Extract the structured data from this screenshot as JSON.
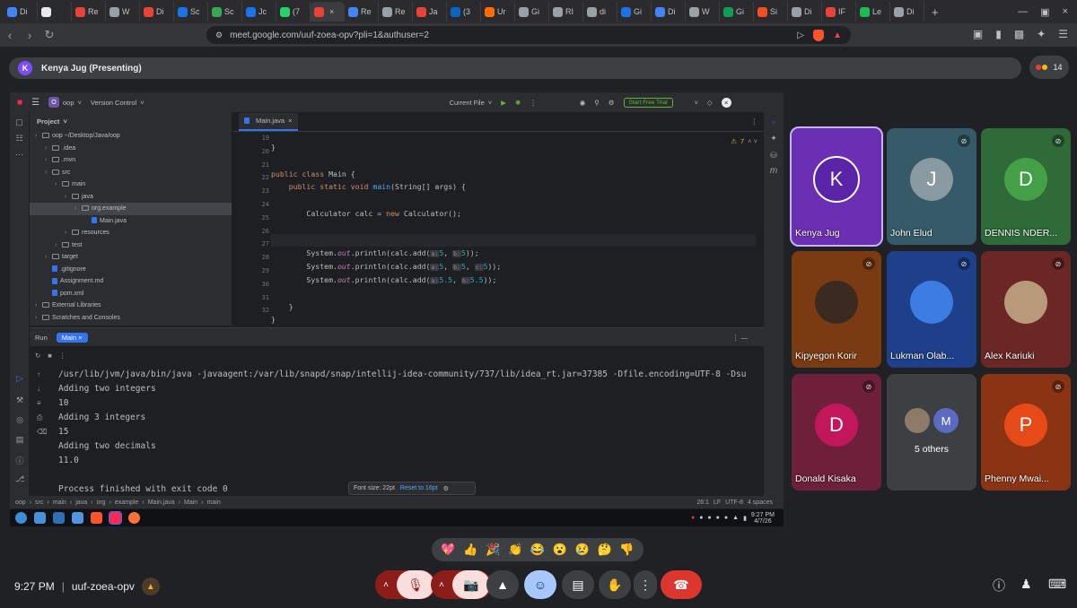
{
  "browser": {
    "tabs": [
      {
        "label": "Di",
        "color": "#4285f4"
      },
      {
        "label": "",
        "color": "#e8eaed"
      },
      {
        "label": "Re",
        "color": "#ea4335"
      },
      {
        "label": "W",
        "color": "#9aa0a6"
      },
      {
        "label": "Di",
        "color": "#ea4335"
      },
      {
        "label": "Sc",
        "color": "#1a73e8"
      },
      {
        "label": "Sc",
        "color": "#34a853"
      },
      {
        "label": "Jc",
        "color": "#1a73e8"
      },
      {
        "label": "(7",
        "color": "#25d366"
      },
      {
        "label": "",
        "color": "#ea4335",
        "active": true
      },
      {
        "label": "Re",
        "color": "#4285f4"
      },
      {
        "label": "Re",
        "color": "#9aa0a6"
      },
      {
        "label": "Ja",
        "color": "#ea4335"
      },
      {
        "label": "(3",
        "color": "#0a66c2"
      },
      {
        "label": "Ur",
        "color": "#ff6d00"
      },
      {
        "label": "Gi",
        "color": "#9aa0a6"
      },
      {
        "label": "RI",
        "color": "#9aa0a6"
      },
      {
        "label": "di",
        "color": "#9aa0a6"
      },
      {
        "label": "Gi",
        "color": "#1a73e8"
      },
      {
        "label": "Di",
        "color": "#4285f4"
      },
      {
        "label": "W",
        "color": "#9aa0a6"
      },
      {
        "label": "Gi",
        "color": "#0f9d58"
      },
      {
        "label": "Si",
        "color": "#f25022"
      },
      {
        "label": "Di",
        "color": "#9aa0a6"
      },
      {
        "label": "IF",
        "color": "#ea4335"
      },
      {
        "label": "Le",
        "color": "#1db954"
      },
      {
        "label": "Di",
        "color": "#9aa0a6"
      }
    ],
    "new_tab": "+",
    "url": "meet.google.com/uuf-zoea-opv?pli=1&authuser=2"
  },
  "meet": {
    "presenter_initial": "K",
    "presenter_label": "Kenya Jug (Presenting)",
    "people_count": "14",
    "tiles": [
      {
        "name": "Kenya Jug",
        "initial": "K",
        "bg": "#6b2fb3",
        "avbg": "#5b24a8",
        "muted": false,
        "active": true
      },
      {
        "name": "John Elud",
        "initial": "J",
        "bg": "#355a68",
        "avbg": "#8a9aa3",
        "muted": true
      },
      {
        "name": "DENNIS NDER...",
        "initial": "D",
        "bg": "#2e6b38",
        "avbg": "#43a047",
        "muted": true
      },
      {
        "name": "Kipyegon Korir",
        "initial": "",
        "bg": "#7a3a12",
        "avbg": "#3a2a20",
        "muted": true
      },
      {
        "name": "Lukman Olab...",
        "initial": "",
        "bg": "#1e3f8a",
        "avbg": "#3b7de0",
        "muted": true
      },
      {
        "name": "Alex Kariuki",
        "initial": "",
        "bg": "#6b2626",
        "avbg": "#b89a7a",
        "muted": true
      },
      {
        "name": "Donald Kisaka",
        "initial": "D",
        "bg": "#6e1f3a",
        "avbg": "#c2185b",
        "muted": true
      },
      {
        "name": "5 others",
        "initial": "M",
        "bg": "#3c4043",
        "avbg": "#5c6bc0",
        "muted": false
      },
      {
        "name": "Phenny Mwai...",
        "initial": "P",
        "bg": "#8a3414",
        "avbg": "#e64a19",
        "muted": true
      }
    ],
    "reactions": [
      "💖",
      "👍",
      "🎉",
      "👏",
      "😂",
      "😮",
      "😢",
      "🤔",
      "👎"
    ],
    "time": "9:27 PM",
    "meeting_code": "uuf-zoea-opv"
  },
  "ide": {
    "project_badge": "O",
    "project_name": "oop",
    "vcs": "Version Control",
    "run_config": "Current File",
    "trial": "Start Free Trial",
    "project_label": "Project",
    "tree": [
      {
        "label": "oop ~/Desktop/Java/oop",
        "depth": 0,
        "type": "folder"
      },
      {
        "label": ".idea",
        "depth": 1,
        "type": "folder"
      },
      {
        "label": ".mvn",
        "depth": 1,
        "type": "folder"
      },
      {
        "label": "src",
        "depth": 1,
        "type": "folder"
      },
      {
        "label": "main",
        "depth": 2,
        "type": "folder"
      },
      {
        "label": "java",
        "depth": 3,
        "type": "folder"
      },
      {
        "label": "org.example",
        "depth": 4,
        "type": "folder",
        "selected": true
      },
      {
        "label": "Main.java",
        "depth": 5,
        "type": "file"
      },
      {
        "label": "resources",
        "depth": 3,
        "type": "folder"
      },
      {
        "label": "test",
        "depth": 2,
        "type": "folder"
      },
      {
        "label": "target",
        "depth": 1,
        "type": "folder"
      },
      {
        "label": ".gitignore",
        "depth": 1,
        "type": "file"
      },
      {
        "label": "Assignment.md",
        "depth": 1,
        "type": "file"
      },
      {
        "label": "pom.xml",
        "depth": 1,
        "type": "file"
      },
      {
        "label": "External Libraries",
        "depth": 0,
        "type": "folder"
      },
      {
        "label": "Scratches and Consoles",
        "depth": 0,
        "type": "folder"
      }
    ],
    "editor_tab": "Main.java",
    "warnings": "7",
    "line_numbers": [
      "19",
      "20",
      "21",
      "22",
      "23",
      "24",
      "25",
      "26",
      "27",
      "28",
      "29",
      "30",
      "31",
      "32"
    ],
    "run_label": "Run",
    "run_tab": "Main",
    "console": [
      "/usr/lib/jvm/java/bin/java -javaagent:/var/lib/snapd/snap/intellij-idea-community/737/lib/idea_rt.jar=37385 -Dfile.encoding=UTF-8 -Dsu",
      "Adding two integers",
      "10",
      "Adding 3 integers",
      "15",
      "Adding two decimals",
      "11.0",
      "",
      "Process finished with exit code 0"
    ],
    "font_popup": "Font size: 22pt",
    "font_reset": "Reset to 16pt",
    "breadcrumb": [
      "oop",
      "src",
      "main",
      "java",
      "org",
      "example",
      "Main.java",
      "Main",
      "main"
    ],
    "position": "26:1",
    "line_sep": "LF",
    "encoding": "UTF-8",
    "indent": "4 spaces",
    "task_time": "9:27 PM",
    "task_date": "4/7/26"
  }
}
